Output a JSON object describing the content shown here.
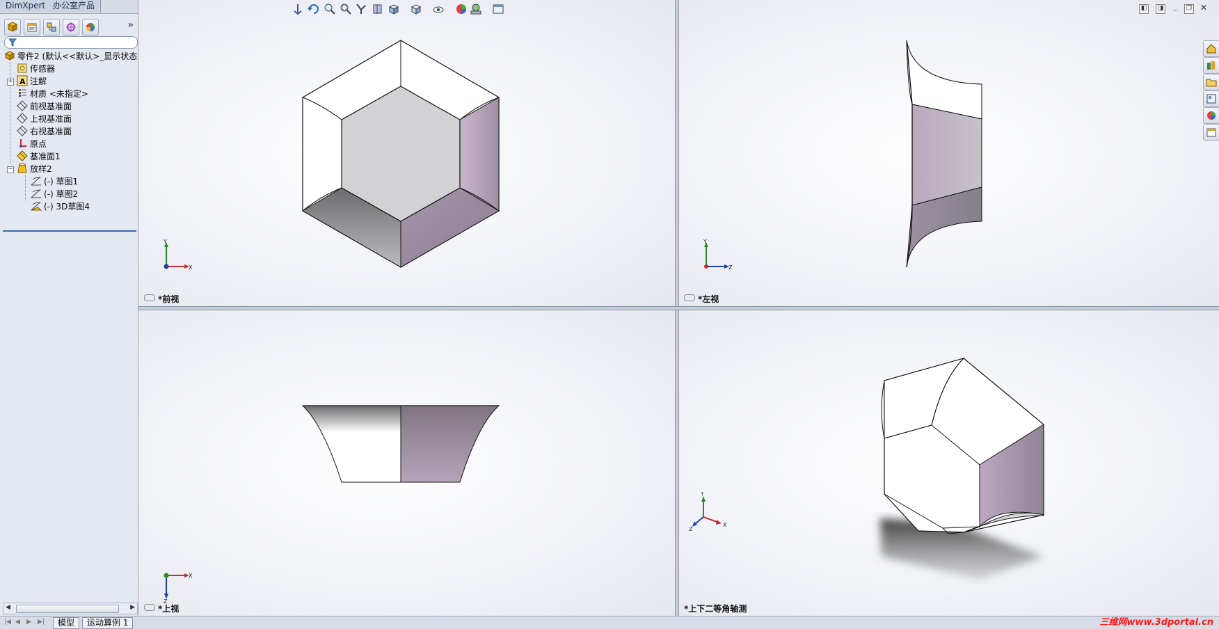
{
  "tabs": {
    "dimxpert": "DimXpert",
    "office": "办公室产品"
  },
  "filter_placeholder": "",
  "more_glyph": "»",
  "tree": {
    "root": "零件2  (默认<<默认>_显示状态",
    "items": [
      {
        "label": "传感器",
        "icon": "sensor-icon"
      },
      {
        "label": "注解",
        "icon": "annotation-icon"
      },
      {
        "label": "材质 <未指定>",
        "icon": "material-icon"
      },
      {
        "label": "前视基准面",
        "icon": "plane-icon"
      },
      {
        "label": "上视基准面",
        "icon": "plane-icon"
      },
      {
        "label": "右视基准面",
        "icon": "plane-icon"
      },
      {
        "label": "原点",
        "icon": "origin-icon"
      },
      {
        "label": "基准面1",
        "icon": "plane-yellow-icon"
      },
      {
        "label": "放样2",
        "icon": "loft-icon"
      },
      {
        "label": "(-) 草图1",
        "icon": "sketch-icon"
      },
      {
        "label": "(-) 草图2",
        "icon": "sketch-icon"
      },
      {
        "label": "(-) 3D草图4",
        "icon": "sketch3d-icon"
      }
    ]
  },
  "bottom_tabs": {
    "model": "模型",
    "motion": "运动算例 1"
  },
  "watermark": "三维网www.3dportal.cn",
  "viewports": {
    "front": {
      "label": "*前视",
      "axes": [
        "Y",
        "X"
      ]
    },
    "left": {
      "label": "*左视",
      "axes": [
        "Y",
        "Z"
      ]
    },
    "top": {
      "label": "*上视",
      "axes": [
        "X",
        "Z"
      ]
    },
    "iso": {
      "label": "*上下二等角轴测",
      "axes": [
        "Y",
        "X",
        "Z"
      ]
    }
  },
  "colors": {
    "accent": "#3b6aa8",
    "purple_face": "#b9a9bd",
    "dark_face": "#7f7f84",
    "light_face": "#d2d2d4"
  }
}
